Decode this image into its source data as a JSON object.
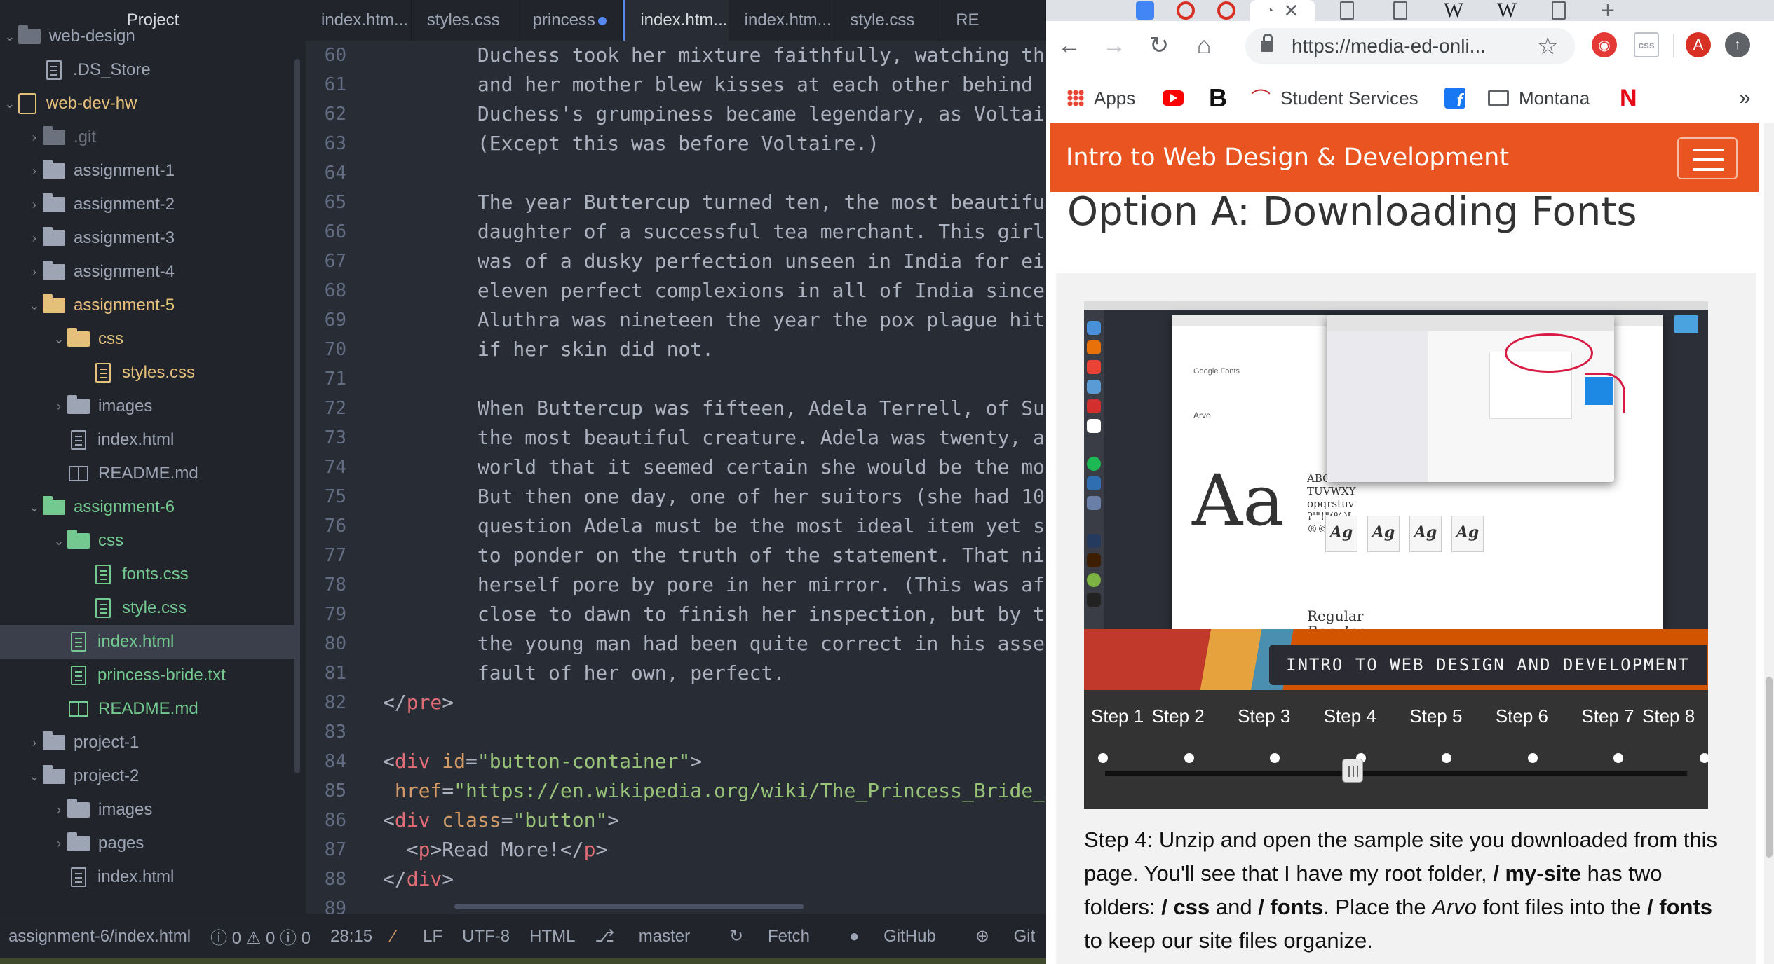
{
  "editor": {
    "tree_title": "Project",
    "tree": [
      {
        "label": "web-design",
        "kind": "folder",
        "depth": 0,
        "arrow": "⌄",
        "color": "gray"
      },
      {
        "label": ".DS_Store",
        "kind": "file",
        "depth": 1,
        "color": "normal"
      },
      {
        "label": "web-dev-hw",
        "kind": "repo",
        "depth": 0,
        "arrow": "⌄",
        "color": "yellow"
      },
      {
        "label": ".git",
        "kind": "folder",
        "depth": 1,
        "arrow": "›",
        "color": "dim"
      },
      {
        "label": "assignment-1",
        "kind": "folder",
        "depth": 1,
        "arrow": "›",
        "color": "normal"
      },
      {
        "label": "assignment-2",
        "kind": "folder",
        "depth": 1,
        "arrow": "›",
        "color": "normal"
      },
      {
        "label": "assignment-3",
        "kind": "folder",
        "depth": 1,
        "arrow": "›",
        "color": "normal"
      },
      {
        "label": "assignment-4",
        "kind": "folder",
        "depth": 1,
        "arrow": "›",
        "color": "normal"
      },
      {
        "label": "assignment-5",
        "kind": "folder",
        "depth": 1,
        "arrow": "⌄",
        "color": "yellow"
      },
      {
        "label": "css",
        "kind": "folder",
        "depth": 2,
        "arrow": "⌄",
        "color": "yellow"
      },
      {
        "label": "styles.css",
        "kind": "file",
        "depth": 3,
        "color": "yellow"
      },
      {
        "label": "images",
        "kind": "folder",
        "depth": 2,
        "arrow": "›",
        "color": "normal"
      },
      {
        "label": "index.html",
        "kind": "file",
        "depth": 2,
        "color": "normal"
      },
      {
        "label": "README.md",
        "kind": "book",
        "depth": 2,
        "color": "normal"
      },
      {
        "label": "assignment-6",
        "kind": "folder",
        "depth": 1,
        "arrow": "⌄",
        "color": "green"
      },
      {
        "label": "css",
        "kind": "folder",
        "depth": 2,
        "arrow": "⌄",
        "color": "green"
      },
      {
        "label": "fonts.css",
        "kind": "file",
        "depth": 3,
        "color": "green"
      },
      {
        "label": "style.css",
        "kind": "file",
        "depth": 3,
        "color": "green"
      },
      {
        "label": "index.html",
        "kind": "file",
        "depth": 2,
        "color": "green",
        "selected": true
      },
      {
        "label": "princess-bride.txt",
        "kind": "file",
        "depth": 2,
        "color": "green"
      },
      {
        "label": "README.md",
        "kind": "book",
        "depth": 2,
        "color": "green"
      },
      {
        "label": "project-1",
        "kind": "folder",
        "depth": 1,
        "arrow": "›",
        "color": "normal"
      },
      {
        "label": "project-2",
        "kind": "folder",
        "depth": 1,
        "arrow": "⌄",
        "color": "normal"
      },
      {
        "label": "images",
        "kind": "folder",
        "depth": 2,
        "arrow": "›",
        "color": "normal"
      },
      {
        "label": "pages",
        "kind": "folder",
        "depth": 2,
        "arrow": "›",
        "color": "normal"
      },
      {
        "label": "index.html",
        "kind": "file",
        "depth": 2,
        "color": "normal"
      }
    ],
    "tabs": [
      {
        "label": "index.htm..."
      },
      {
        "label": "styles.css"
      },
      {
        "label": "princess",
        "modified": true
      },
      {
        "label": "index.htm...",
        "active": true
      },
      {
        "label": "index.htm..."
      },
      {
        "label": "style.css"
      },
      {
        "label": "RE"
      }
    ],
    "line_numbers": [
      "60",
      "61",
      "62",
      "63",
      "64",
      "65",
      "66",
      "67",
      "68",
      "69",
      "70",
      "71",
      "72",
      "73",
      "74",
      "75",
      "76",
      "77",
      "78",
      "79",
      "80",
      "81",
      "82",
      "83",
      "84",
      "85",
      "86",
      "87",
      "88",
      "89"
    ],
    "code_lines": [
      [
        {
          "t": "        Duchess took her mixture faithfully, watching th"
        }
      ],
      [
        {
          "t": "        and her mother blew kisses at each other behind"
        }
      ],
      [
        {
          "t": "        Duchess's grumpiness became legendary, as Voltai"
        }
      ],
      [
        {
          "t": "        (Except this was before Voltaire.)"
        }
      ],
      [
        {
          "t": ""
        }
      ],
      [
        {
          "t": "        The year Buttercup turned ten, the most beautifu"
        }
      ],
      [
        {
          "t": "        daughter of a successful tea merchant. This girl"
        }
      ],
      [
        {
          "t": "        was of a dusky perfection unseen in India for ei"
        }
      ],
      [
        {
          "t": "        eleven perfect complexions in all of India since"
        }
      ],
      [
        {
          "t": "        Aluthra was nineteen the year the pox plague hit"
        }
      ],
      [
        {
          "t": "        if her skin did not."
        }
      ],
      [
        {
          "t": ""
        }
      ],
      [
        {
          "t": "        When Buttercup was fifteen, Adela Terrell, of Su"
        }
      ],
      [
        {
          "t": "        the most beautiful creature. Adela was twenty, a"
        }
      ],
      [
        {
          "t": "        world that it seemed certain she would be the mo"
        }
      ],
      [
        {
          "t": "        But then one day, one of her suitors (she had 10"
        }
      ],
      [
        {
          "t": "        question Adela must be the most ideal item yet s"
        }
      ],
      [
        {
          "t": "        to ponder on the truth of the statement. That ni"
        }
      ],
      [
        {
          "t": "        herself pore by pore in her mirror. (This was af"
        }
      ],
      [
        {
          "t": "        close to dawn to finish her inspection, but by t"
        }
      ],
      [
        {
          "t": "        the young man had been quite correct in his asse"
        }
      ],
      [
        {
          "t": "        fault of her own, perfect."
        }
      ],
      [
        {
          "t": "</"
        },
        {
          "t": "pre",
          "c": "ct"
        },
        {
          "t": ">"
        }
      ],
      [
        {
          "t": ""
        }
      ],
      [
        {
          "t": "<"
        },
        {
          "t": "div",
          "c": "ct"
        },
        {
          "t": " "
        },
        {
          "t": "id",
          "c": "ca"
        },
        {
          "t": "="
        },
        {
          "t": "\"button-container\"",
          "c": "cs"
        },
        {
          "t": ">"
        }
      ],
      [
        {
          "t": " "
        },
        {
          "t": "href",
          "c": "ca"
        },
        {
          "t": "="
        },
        {
          "t": "\"https://en.wikipedia.org/wiki/The_Princess_Bride_",
          "c": "cs"
        }
      ],
      [
        {
          "t": "<"
        },
        {
          "t": "div",
          "c": "ct"
        },
        {
          "t": " "
        },
        {
          "t": "class",
          "c": "ca"
        },
        {
          "t": "="
        },
        {
          "t": "\"button\"",
          "c": "cs"
        },
        {
          "t": ">"
        }
      ],
      [
        {
          "t": "  <"
        },
        {
          "t": "p",
          "c": "ct"
        },
        {
          "t": ">Read More!</"
        },
        {
          "t": "p",
          "c": "ct"
        },
        {
          "t": ">"
        }
      ],
      [
        {
          "t": "</"
        },
        {
          "t": "div",
          "c": "ct"
        },
        {
          "t": ">"
        }
      ],
      [
        {
          "t": ""
        }
      ]
    ],
    "status": {
      "path": "assignment-6/index.html",
      "diagnostics": "ⓘ 0 ⚠ 0 ⓘ 0",
      "cursor": "28:15",
      "line_ending": "LF",
      "encoding": "UTF-8",
      "grammar": "HTML",
      "branch": "master",
      "fetch": "Fetch",
      "github": "GitHub",
      "git": "Git"
    }
  },
  "browser": {
    "url": "https://media-ed-onli...",
    "bookmarks": [
      {
        "label": "Apps",
        "icon": "apps-icon"
      },
      {
        "label": "",
        "icon": "youtube-icon"
      },
      {
        "label": "B",
        "icon": "bold-b-icon"
      },
      {
        "label": "Student Services",
        "icon": "student-services-icon"
      },
      {
        "label": "",
        "icon": "facebook-icon"
      },
      {
        "label": "Montana",
        "icon": "folder-icon"
      },
      {
        "label": "N",
        "icon": "netflix-icon"
      }
    ],
    "more_bookmarks": "»",
    "avatar_letter": "A",
    "site_title": "Intro to Web Design & Development",
    "heading": "Option A: Downloading Fonts",
    "slide": {
      "caption": "INTRO TO WEB DESIGN AND DEVELOPMENT",
      "google_fonts_label": "Google Fonts",
      "font_name": "Arvo",
      "glyph_preview": "Aa",
      "styles": [
        "Regular",
        "Regular"
      ],
      "chars_preview": [
        "ABCI",
        "TUVWXY",
        "opqrstuv",
        "?'\"!\"(%)[",
        "®©$£¥¢:"
      ],
      "font_files": [
        "Ag",
        "Ag",
        "Ag",
        "Ag"
      ]
    },
    "steps": [
      "Step 1",
      "Step 2",
      "Step 3",
      "Step 4",
      "Step 5",
      "Step 6",
      "Step 7",
      "Step 8"
    ],
    "current_step": 4,
    "description": {
      "p1": "Step 4: Unzip and open the sample site you downloaded from this page. You'll see that I have my root folder, ",
      "b1": "/ my-site",
      "p2": " has two folders: ",
      "b2": "/ css",
      "p3": " and ",
      "b3": "/ fonts",
      "p4": ". Place the ",
      "i1": "Arvo",
      "p5": " font files into the ",
      "b4": "/ fonts",
      "p6": " to keep our site files organize."
    },
    "colors": {
      "header": "#e95420",
      "accent": "#d81b43"
    }
  }
}
